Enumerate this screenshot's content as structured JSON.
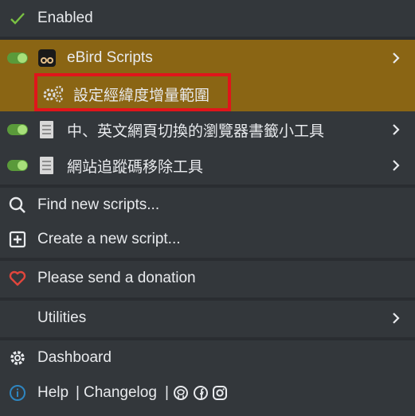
{
  "menu": {
    "enabled_label": "Enabled",
    "script_ebird": "eBird Scripts",
    "ebird_command": "設定經緯度增量範圍",
    "script_toolbox": "中、英文網頁切換的瀏覽器書籤小工具",
    "script_tracker": "網站追蹤碼移除工具",
    "find_scripts": "Find new scripts...",
    "create_script": "Create a new script...",
    "donation": "Please send a donation",
    "utilities": "Utilities",
    "dashboard": "Dashboard",
    "help": "Help",
    "changelog": "Changelog",
    "divider1": "|",
    "divider2": "|"
  },
  "colors": {
    "background": "#33373b",
    "selected_row": "#8a6514",
    "toggle_on": "#5a9a3a",
    "check": "#7ac143",
    "heart": "#e0463c",
    "info": "#2e86c1",
    "highlight_border": "#e0151b"
  },
  "icons": [
    "check-icon",
    "toggle-icon",
    "script-icon",
    "gears-icon",
    "document-icon",
    "search-icon",
    "plus-square-icon",
    "heart-icon",
    "gear-icon",
    "info-icon",
    "github-icon",
    "facebook-icon",
    "instagram-icon",
    "chevron-right-icon"
  ]
}
